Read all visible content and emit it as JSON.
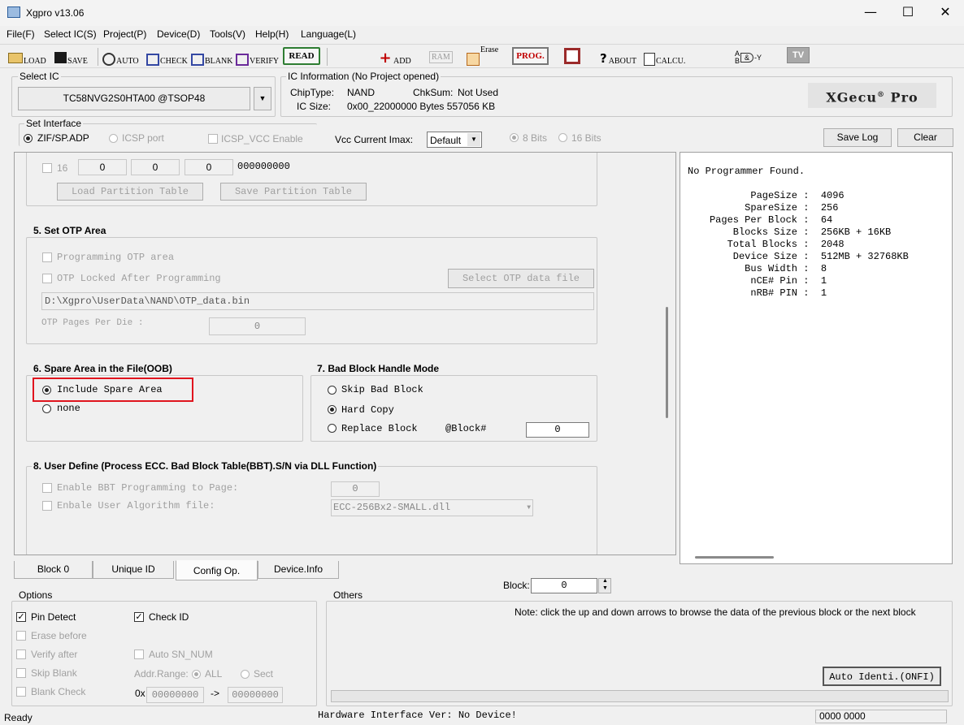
{
  "window": {
    "title": "Xgpro v13.06"
  },
  "menu": [
    "File(F)",
    "Select IC(S)",
    "Project(P)",
    "Device(D)",
    "Tools(V)",
    "Help(H)",
    "Language(L)"
  ],
  "toolbar": {
    "load": "LOAD",
    "save": "SAVE",
    "auto": "AUTO",
    "check": "CHECK",
    "blank": "BLANK",
    "verify": "VERIFY",
    "read": "READ",
    "add": "ADD",
    "ram": "RAM",
    "erase": "Erase",
    "prog": "PROG.",
    "about": "ABOUT",
    "calcu": "CALCU.",
    "logic_in": "A\nB",
    "logic_gate": "&",
    "logic_out": "-Y",
    "tv": "TV"
  },
  "select_ic": {
    "label": "Select IC",
    "value": "TC58NVG2S0HTA00 @TSOP48"
  },
  "ic_info": {
    "label": "IC Information (No Project opened)",
    "chip_type_label": "ChipType:",
    "chip_type": "NAND",
    "chksum_label": "ChkSum:",
    "chksum": "Not Used",
    "ic_size_label": "IC Size:",
    "ic_size": "0x00_22000000 Bytes 557056 KB",
    "logo_main": "XGecu",
    "logo_reg": "®",
    "logo_suffix": "Pro"
  },
  "interface": {
    "label": "Set Interface",
    "zif": "ZIF/SP.ADP",
    "icsp": "ICSP port",
    "icsp_vcc": "ICSP_VCC Enable",
    "vcc_label": "Vcc Current Imax:",
    "vcc_value": "Default",
    "bits8": "8 Bits",
    "bits16": "16 Bits"
  },
  "log_buttons": {
    "save": "Save Log",
    "clear": "Clear"
  },
  "partition": {
    "row_num": "16",
    "v1": "0",
    "v2": "0",
    "v3": "0",
    "hex": "000000000",
    "load": "Load Partition Table",
    "save": "Save Partition Table"
  },
  "otp": {
    "title": "5. Set OTP Area",
    "programming": "Programming  OTP area",
    "locked": "OTP Locked After Programming",
    "select_file": "Select OTP data file",
    "path": "D:\\Xgpro\\UserData\\NAND\\OTP_data.bin",
    "pages_label": "OTP Pages Per Die :",
    "pages_value": "0"
  },
  "spare": {
    "title": "6. Spare Area in the File(OOB)",
    "include": "Include Spare Area",
    "none": "none"
  },
  "badblock": {
    "title": "7. Bad Block Handle Mode",
    "skip": "Skip Bad Block",
    "hard": "Hard Copy",
    "replace": "Replace Block",
    "at_block": "@Block#",
    "at_value": "0"
  },
  "userdef": {
    "title": "8. User Define (Process ECC. Bad Block Table(BBT).S/N via DLL Function)",
    "bbt": "Enable BBT Programming to Page:",
    "bbt_value": "0",
    "algo": "Enbale User Algorithm file:",
    "algo_value": "ECC-256Bx2-SMALL.dll"
  },
  "log": {
    "line0": "No Programmer Found.",
    "rows": [
      {
        "k": "     PageSize",
        "v": "4096"
      },
      {
        "k": "    SpareSize",
        "v": "256"
      },
      {
        "k": "Pages Per Block",
        "v": "64"
      },
      {
        "k": "   Blocks Size",
        "v": "256KB + 16KB"
      },
      {
        "k": "  Total Blocks",
        "v": "2048"
      },
      {
        "k": "   Device Size",
        "v": "512MB + 32768KB"
      },
      {
        "k": "     Bus Width",
        "v": "8"
      },
      {
        "k": "      nCE# Pin",
        "v": "1"
      },
      {
        "k": "      nRB# PIN",
        "v": "1"
      }
    ]
  },
  "tabs": [
    "Block 0",
    "Unique ID",
    "Config Op.",
    "Device.Info"
  ],
  "block": {
    "label": "Block:",
    "value": "0"
  },
  "options": {
    "label": "Options",
    "pin_detect": "Pin Detect",
    "check_id": "Check ID",
    "erase_before": "Erase before",
    "verify_after": "Verify after",
    "auto_sn": "Auto SN_NUM",
    "skip_blank": "Skip Blank",
    "addr_range": "Addr.Range:",
    "all": "ALL",
    "sect": "Sect",
    "blank_check": "Blank Check",
    "ox": "0x",
    "from": "00000000",
    "arrow": "->",
    "to": "00000000"
  },
  "others": {
    "label": "Others",
    "note": "Note: click the up and down arrows to browse the data of the previous block or the next block",
    "auto_identi": "Auto Identi.(ONFI)"
  },
  "status": {
    "ready": "Ready",
    "hw": "Hardware Interface Ver: No Device!",
    "code": "0000 0000"
  },
  "colors": {
    "highlight_box": "#e0141e",
    "read_border": "#2e7d32",
    "prog_red": "#c00000"
  }
}
